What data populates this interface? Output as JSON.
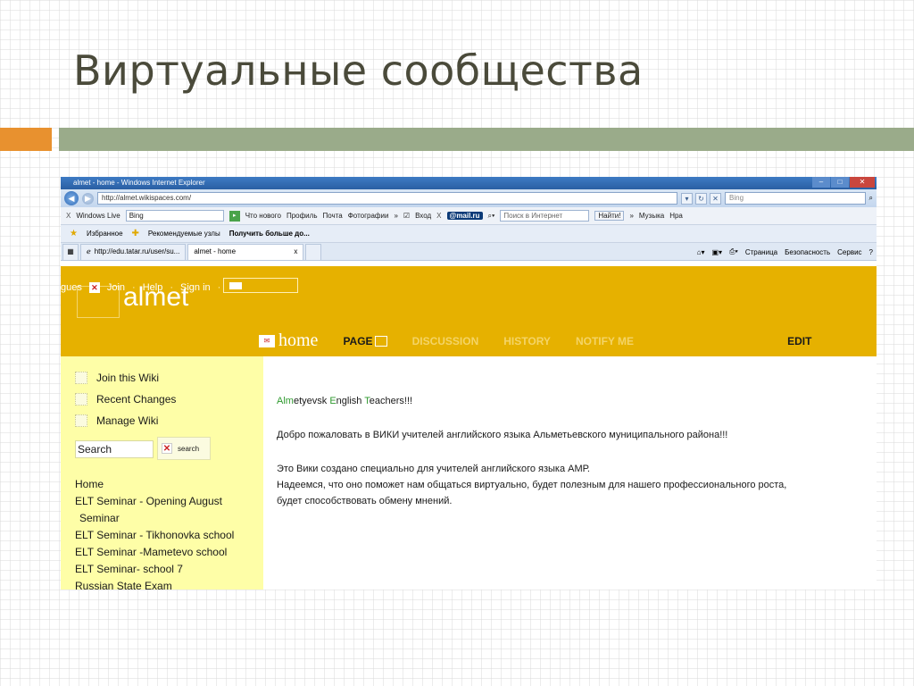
{
  "slide": {
    "title": "Виртуальные сообщества"
  },
  "browser": {
    "window_title": "almet - home - Windows Internet Explorer",
    "address": "http://almet.wikispaces.com/",
    "bing_placeholder": "Bing",
    "toolbar1": {
      "close": "X",
      "windows_live": "Windows Live",
      "bing_input": "Bing",
      "links": [
        "Что нового",
        "Профиль",
        "Почта",
        "Фотографии"
      ],
      "more": "»",
      "login": "Вход",
      "mailru": "@mail.ru",
      "internet_search_placeholder": "Поиск в Интернет",
      "find": "Найти!",
      "music": "Музыка",
      "hr": "Нра"
    },
    "favorites": {
      "label": "Избранное",
      "recommended": "Рекомендуемые узлы",
      "get_more": "Получить больше до..."
    },
    "tabs": [
      {
        "label": "http://edu.tatar.ru/user/su..."
      },
      {
        "label": "almet - home",
        "close": "x"
      }
    ],
    "tools": [
      "Страница",
      "Безопасность",
      "Сервис"
    ]
  },
  "wiki": {
    "guest_links": [
      "gues",
      "Join",
      "Help",
      "Sign in"
    ],
    "name": "almet",
    "nav": {
      "home": "home",
      "page": "PAGE",
      "discussion": "DISCUSSION",
      "history": "HISTORY",
      "notify": "NOTIFY ME",
      "edit": "EDIT"
    },
    "sidebar": {
      "links": [
        "Join this Wiki",
        "Recent Changes",
        "Manage Wiki"
      ],
      "search_value": "Search",
      "search_button": "search",
      "nav": [
        "Home",
        "ELT Seminar - Opening August",
        " Seminar",
        "ELT Seminar - Tikhonovka school",
        "ELT Seminar -Mametevo school",
        "ELT Seminar- school 7",
        "Russian State Exam"
      ]
    },
    "content": {
      "heading_parts": [
        "Alm",
        "etyevsk ",
        "E",
        "nglish ",
        "T",
        "eachers!!!"
      ],
      "welcome": "Добро пожаловать в ВИКИ учителей английского языка Альметьевского муниципального района!!!",
      "line1": "Это Вики создано специально для учителей английского языка АМР.",
      "line2": "Надеемся, что оно поможет нам общаться виртуально, будет полезным для нашего профессионального роста,",
      "line3": "будет способствовать обмену мнений."
    }
  }
}
